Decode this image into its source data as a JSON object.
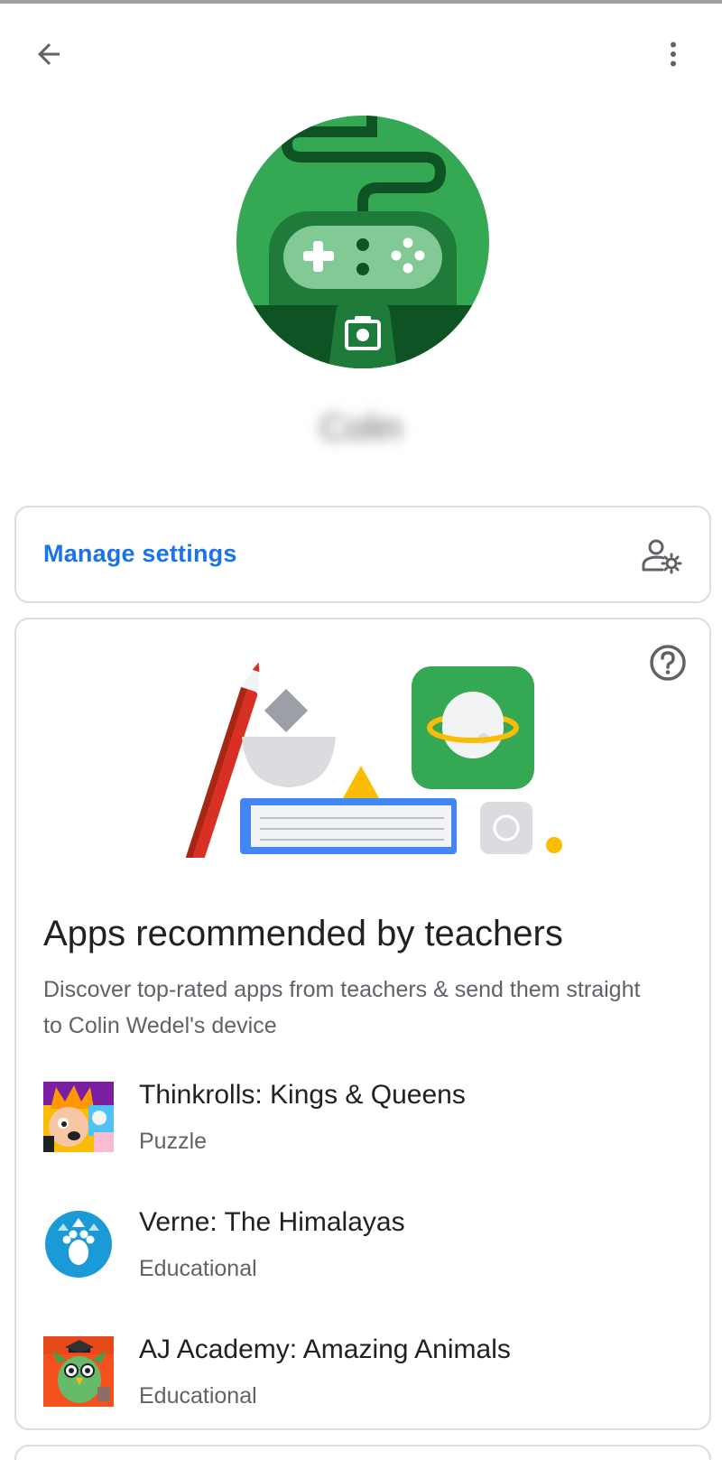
{
  "header": {
    "back_icon": "arrow-back-icon",
    "more_icon": "more-vert-icon"
  },
  "profile": {
    "avatar_icon": "gamepad-avatar",
    "camera_icon": "camera-icon",
    "name": "Colin",
    "avatar_color": "#34a853"
  },
  "manage": {
    "label": "Manage settings",
    "icon": "manage-accounts-icon",
    "link_color": "#1a73e8"
  },
  "recommended": {
    "help_icon": "help-icon",
    "title": "Apps recommended by teachers",
    "description": "Discover top-rated apps from teachers & send them straight to Colin Wedel's device",
    "apps": [
      {
        "name": "Thinkrolls: Kings & Queens",
        "category": "Puzzle",
        "icon": "thinkrolls-app-icon"
      },
      {
        "name": "Verne: The Himalayas",
        "category": "Educational",
        "icon": "verne-app-icon"
      },
      {
        "name": "AJ Academy: Amazing Animals",
        "category": "Educational",
        "icon": "aj-academy-app-icon"
      }
    ]
  }
}
